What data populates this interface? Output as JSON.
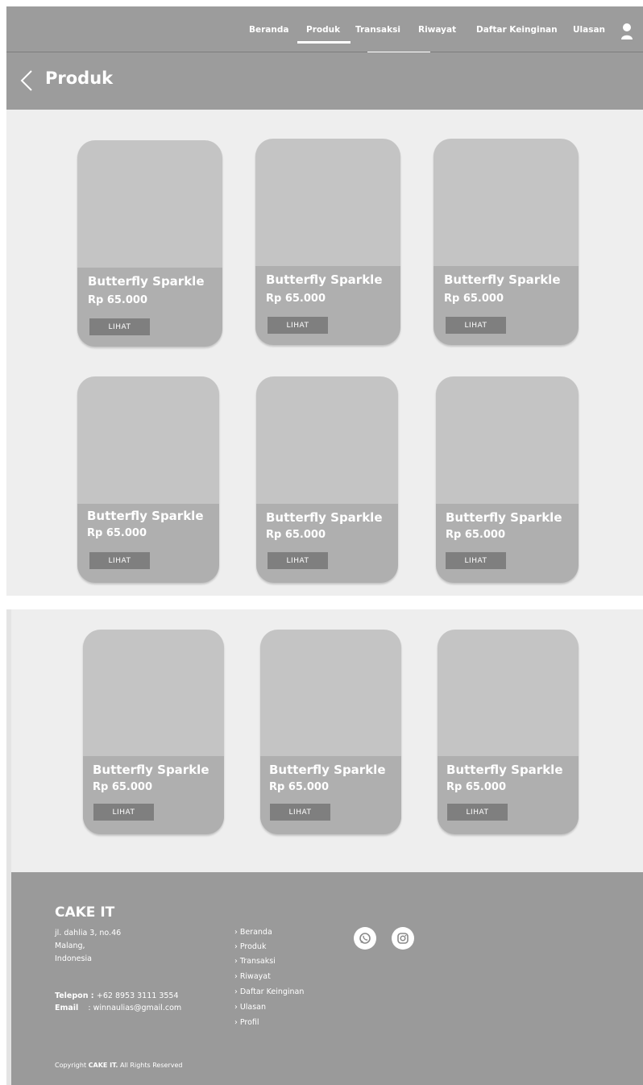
{
  "nav": {
    "links": [
      "Beranda",
      "Produk",
      "Transaksi",
      "Riwayat",
      "Daftar Keinginan",
      "Ulasan"
    ],
    "active": "Produk"
  },
  "page": {
    "title": "Produk"
  },
  "products": [
    {
      "name": "Butterfly Sparkle",
      "price": "Rp 65.000",
      "button": "LIHAT"
    },
    {
      "name": "Butterfly Sparkle",
      "price": "Rp 65.000",
      "button": "LIHAT"
    },
    {
      "name": "Butterfly Sparkle",
      "price": "Rp 65.000",
      "button": "LIHAT"
    },
    {
      "name": "Butterfly Sparkle",
      "price": "Rp 65.000",
      "button": "LIHAT"
    },
    {
      "name": "Butterfly Sparkle",
      "price": "Rp 65.000",
      "button": "LIHAT"
    },
    {
      "name": "Butterfly Sparkle",
      "price": "Rp 65.000",
      "button": "LIHAT"
    },
    {
      "name": "Butterfly Sparkle",
      "price": "Rp 65.000",
      "button": "LIHAT"
    },
    {
      "name": "Butterfly Sparkle",
      "price": "Rp 65.000",
      "button": "LIHAT"
    },
    {
      "name": "Butterfly Sparkle",
      "price": "Rp 65.000",
      "button": "LIHAT"
    }
  ],
  "footer": {
    "brand": "CAKE IT",
    "address": [
      "jl. dahlia 3, no.46",
      "Malang,",
      "Indonesia"
    ],
    "phone_label": "Telepon",
    "phone": "+62 8953 3111 3554",
    "email_label": "Email",
    "email": "winnaulias@gmail.com",
    "links": [
      "› Beranda",
      "› Produk",
      "› Transaksi",
      "› Riwayat",
      "› Daftar Keinginan",
      "› Ulasan",
      "› Profil"
    ],
    "social_icons": [
      "whatsapp-icon",
      "instagram-icon"
    ],
    "copyright_prefix": "Copyright",
    "copyright_brand": "CAKE IT.",
    "copyright_suffix": "All Rights Reserved"
  },
  "colors": {
    "header_bg": "#9c9c9c",
    "content_bg": "#eeeeee",
    "card_top": "#c4c4c4",
    "card_bottom": "#afafaf",
    "button_bg": "#7f7f7f",
    "footer_bg": "#9a9a9a"
  }
}
